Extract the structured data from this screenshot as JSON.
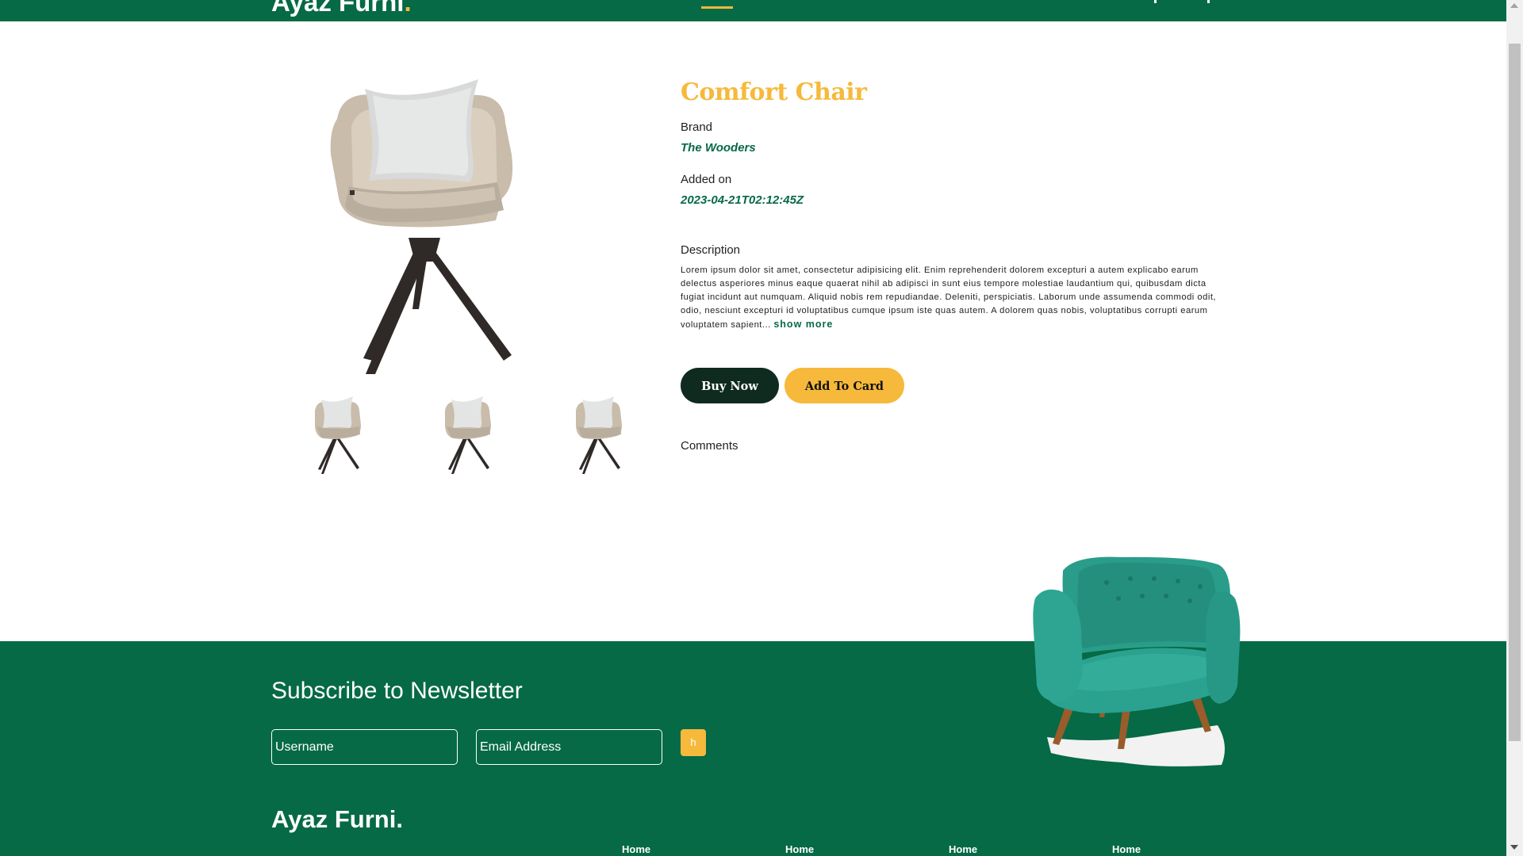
{
  "header": {
    "logo_text": "Ayaz Furni",
    "logo_dot": "."
  },
  "product": {
    "title": "Comfort Chair",
    "brand_label": "Brand",
    "brand_value": "The Wooders",
    "added_label": "Added on",
    "added_value": "2023-04-21T02:12:45Z",
    "description_label": "Description",
    "description_text": "Lorem ipsum dolor sit amet, consectetur adipisicing elit. Enim reprehenderit dolorem excepturi a autem explicabo earum delectus asperiores minus eaque quaerat nihil ab adipisci in sunt eius tempore molestiae laudantium qui, quibusdam dicta fugiat incidunt aut numquam. Aliquid nobis rem repudiandae. Deleniti, perspiciatis. Laborum unde assumenda commodi odit, odio, nesciunt excepturi id voluptatibus cumque ipsum iste quas autem. A dolorem quas nobis, voluptatibus corrupti earum voluptatem sapient...",
    "show_more": "show more",
    "buy_label": "Buy Now",
    "add_label": "Add To Card",
    "comments_label": "Comments"
  },
  "footer": {
    "newsletter_title": "Subscribe to Newsletter",
    "username_placeholder": "Username",
    "email_placeholder": "Email Address",
    "submit_label": "h",
    "logo": "Ayaz Furni.",
    "links": [
      "Home",
      "Home",
      "Home",
      "Home"
    ]
  },
  "colors": {
    "brand_green": "#056a45",
    "accent_yellow": "#f6b93b",
    "dark_button": "#0f2b1f",
    "armchair_teal": "#2a9d8a"
  }
}
